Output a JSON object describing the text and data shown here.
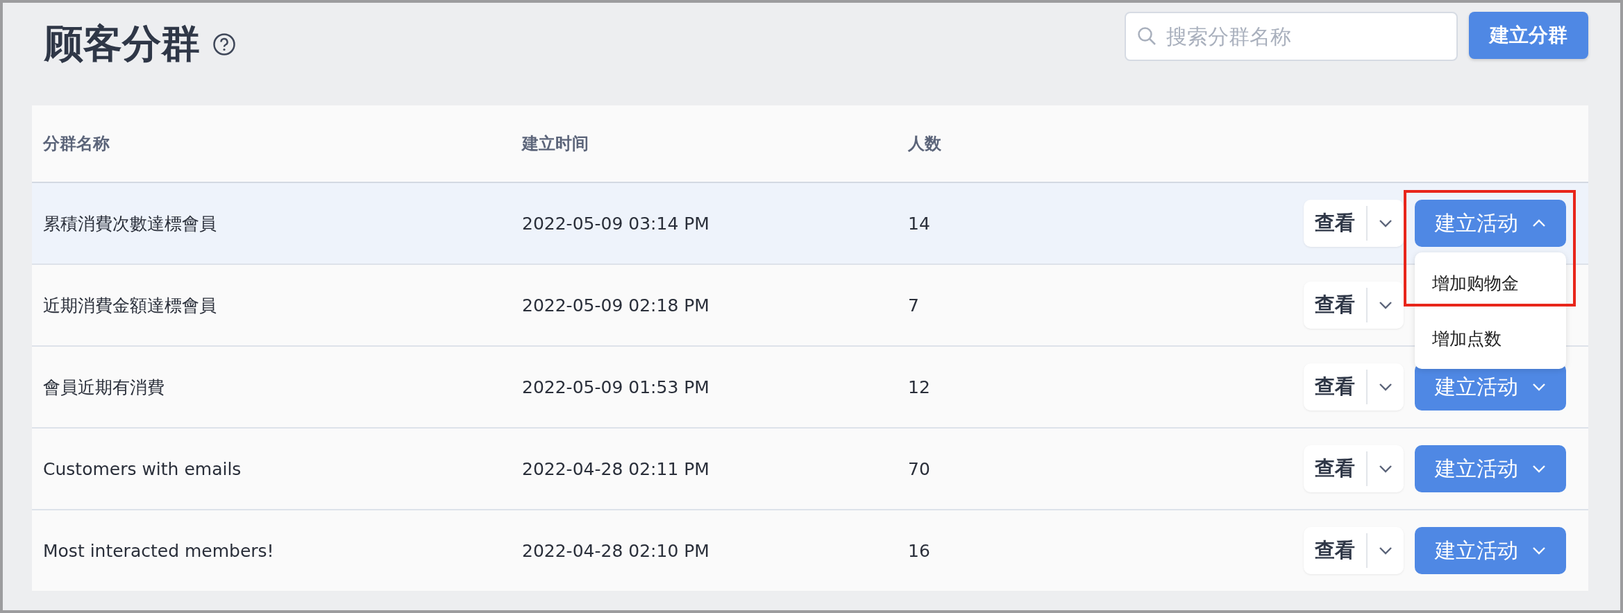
{
  "page_title": "顾客分群",
  "search": {
    "placeholder": "搜索分群名称"
  },
  "create_button": "建立分群",
  "table": {
    "columns": [
      "分群名称",
      "建立时间",
      "人数"
    ],
    "rows": [
      {
        "name": "累積消費次數達標會員",
        "created": "2022-05-09 03:14 PM",
        "count": "14",
        "view": "查看",
        "action": "建立活动",
        "hovered": true,
        "expanded": true,
        "highlighted": true,
        "menu": [
          "增加购物金",
          "增加点数"
        ]
      },
      {
        "name": "近期消費金額達標會員",
        "created": "2022-05-09 02:18 PM",
        "count": "7",
        "view": "查看",
        "hovered": false,
        "expanded": false,
        "highlighted": false
      },
      {
        "name": "會員近期有消費",
        "created": "2022-05-09 01:53 PM",
        "count": "12",
        "view": "查看",
        "action": "建立活动",
        "hovered": false,
        "expanded": false,
        "highlighted": false
      },
      {
        "name": "Customers with emails",
        "created": "2022-04-28 02:11 PM",
        "count": "70",
        "view": "查看",
        "action": "建立活动",
        "hovered": false,
        "expanded": false,
        "highlighted": false
      },
      {
        "name": "Most interacted members!",
        "created": "2022-04-28 02:10 PM",
        "count": "16",
        "view": "查看",
        "action": "建立活动",
        "hovered": false,
        "expanded": false,
        "highlighted": false
      }
    ]
  }
}
